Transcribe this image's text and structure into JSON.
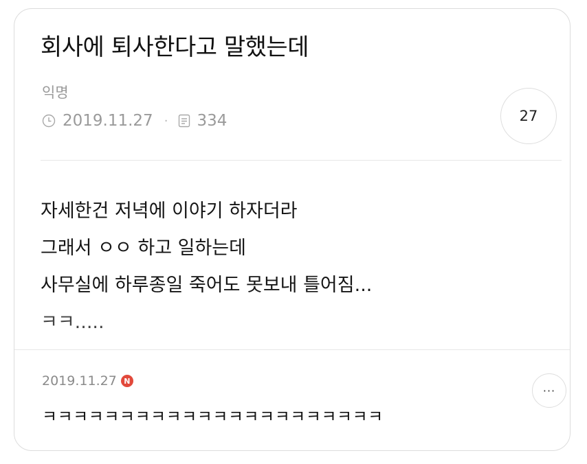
{
  "post": {
    "title": "회사에 퇴사한다고 말했는데",
    "author": "익명",
    "date": "2019.11.27",
    "separator": "·",
    "views": "334",
    "comment_count": "27",
    "body_lines": [
      "자세한건 저녁에 이야기 하자더라",
      "그래서 ㅇㅇ 하고 일하는데",
      "사무실에 하루종일 죽어도 못보내 틀어짐...",
      "ㅋㅋ.....  "
    ]
  },
  "reply": {
    "date": "2019.11.27",
    "new_badge": "N",
    "more_label": "···",
    "text": "ㅋㅋㅋㅋㅋㅋㅋㅋㅋㅋㅋㅋㅋㅋㅋㅋㅋㅋㅋㅋㅋㅋ"
  },
  "icons": {
    "date": "clock-icon",
    "views": "document-icon",
    "new": "new-badge-icon",
    "more": "more-icon"
  },
  "colors": {
    "title": "#111111",
    "meta": "#9a9a9a",
    "badge": "#e2493b",
    "border": "#dcdcdc"
  }
}
